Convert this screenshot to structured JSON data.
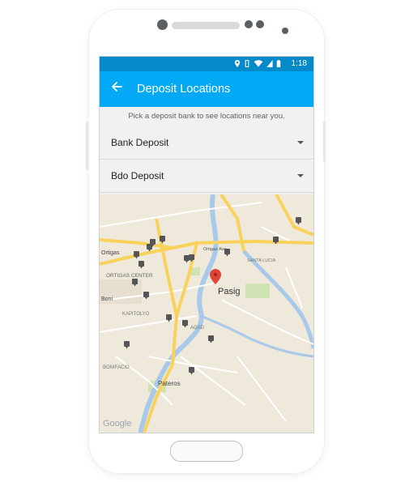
{
  "status_bar": {
    "time": "1:18",
    "icons": [
      "location-icon",
      "vibrate-icon",
      "wifi-icon",
      "signal-icon",
      "battery-icon"
    ]
  },
  "app_bar": {
    "title": "Deposit Locations",
    "back_icon": "arrow-left-icon"
  },
  "hint_text": "Pick a deposit bank to see locations near you.",
  "dropdowns": [
    {
      "selected": "Bank Deposit"
    },
    {
      "selected": "Bdo Deposit"
    }
  ],
  "map": {
    "labels": {
      "pasig": "Pasig",
      "ortigas": "Ortigas",
      "ortigas_center": "ORTIGAS CENTER",
      "ortigas_ave": "Ortigas Ave",
      "santa_lucia": "SANTA LUCIA",
      "kapitolyo": "KAPITOLYO",
      "bagad": "AGAD",
      "bonifacio": "BONIFACIO",
      "pateros": "Pateros",
      "boni": "Boni",
      "google": "Google"
    },
    "colors": {
      "land": "#efe9dc",
      "major_road": "#f9d25c",
      "minor_road": "#ffffff",
      "water": "#a9c9ea",
      "park": "#cfe3b5",
      "pin_red": "#e0453a",
      "marker": "#555555"
    }
  }
}
